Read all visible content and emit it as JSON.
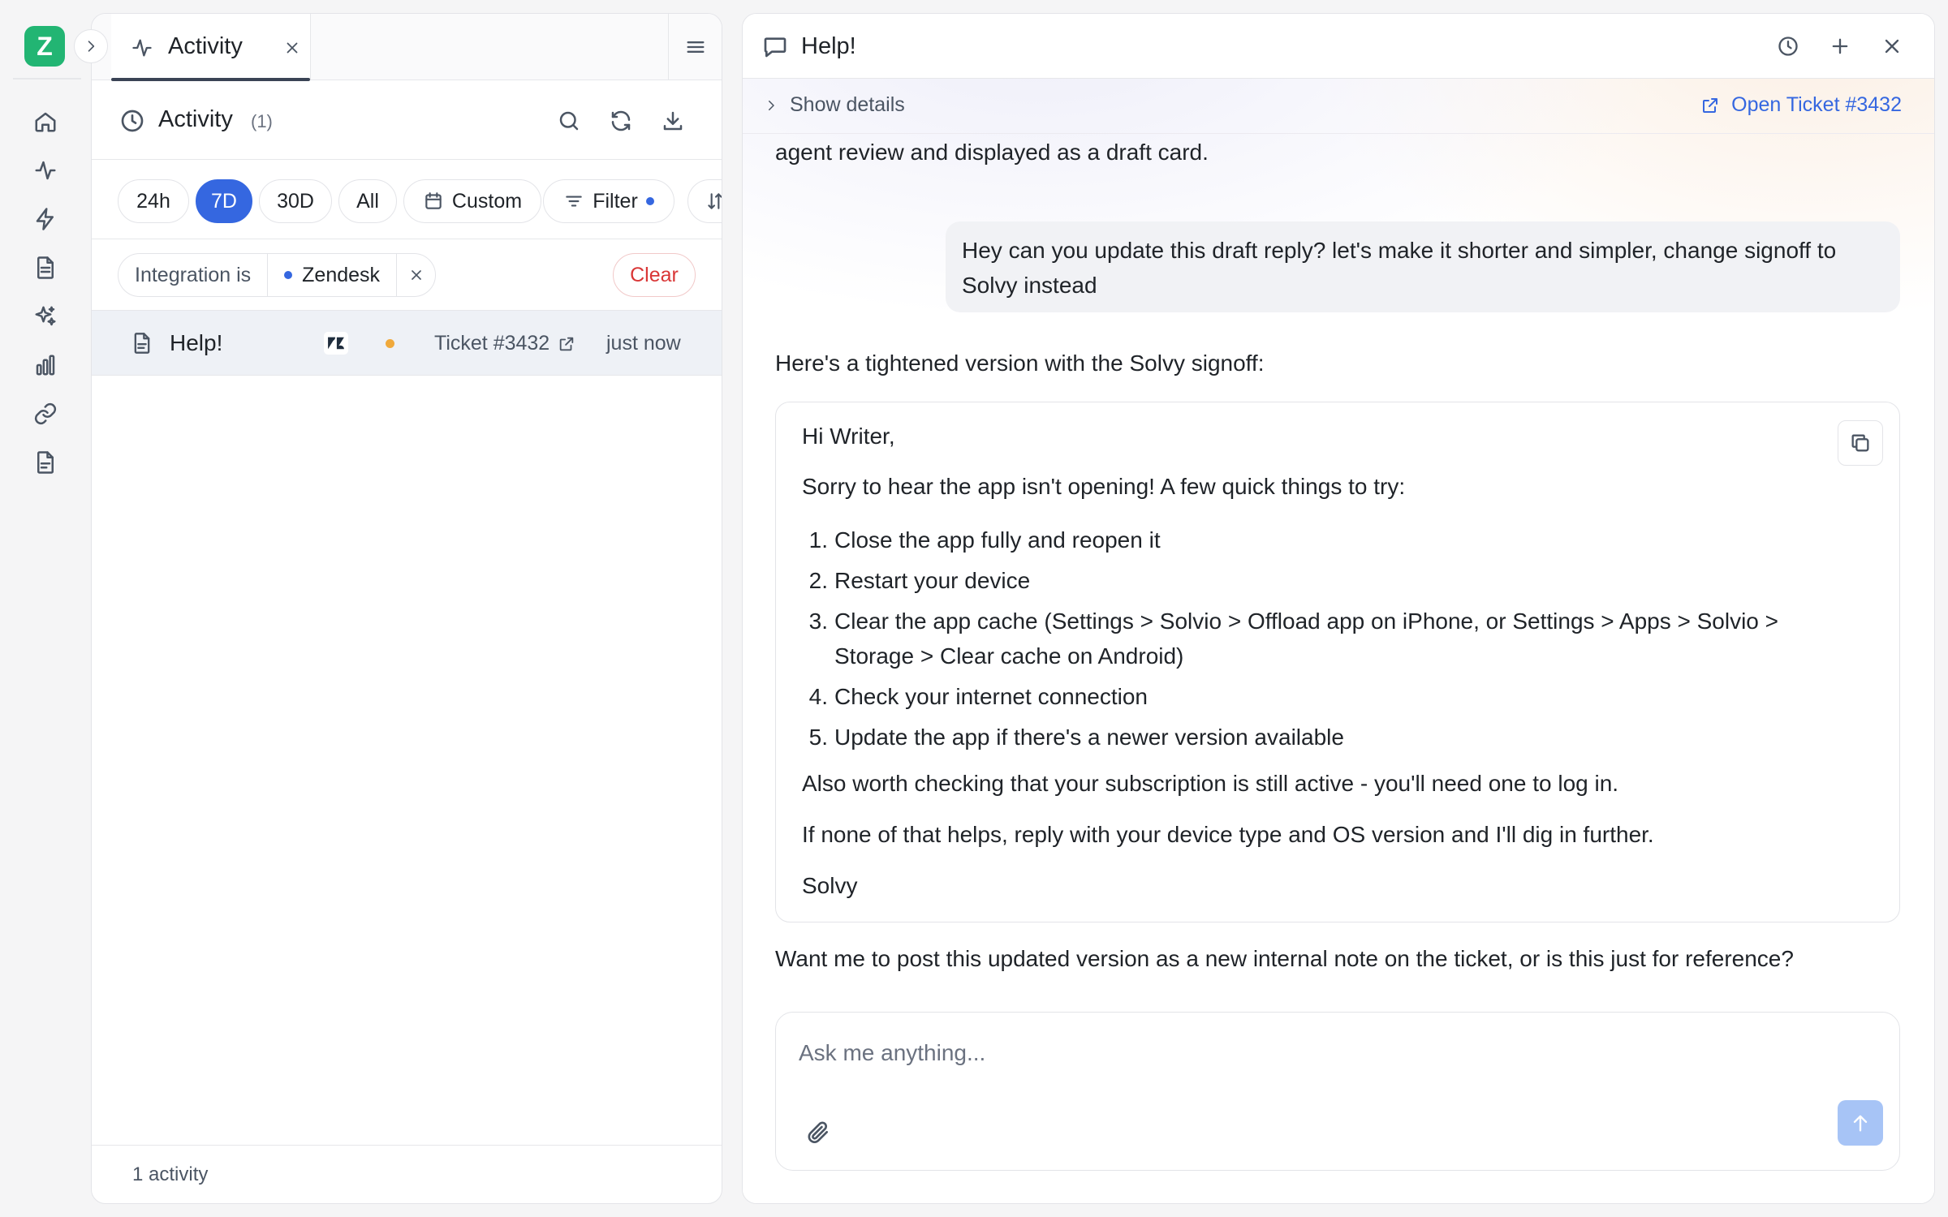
{
  "rail": {
    "avatar_letter": "Z",
    "items": [
      "home-icon",
      "activity-icon",
      "lightning-icon",
      "document-icon",
      "sparkles-icon",
      "bar-chart-icon",
      "link-icon",
      "file-text-icon"
    ]
  },
  "activity": {
    "tab_label": "Activity",
    "title": "Activity",
    "count": "(1)",
    "ranges": [
      "24h",
      "7D",
      "30D",
      "All"
    ],
    "active_range": "7D",
    "custom_label": "Custom",
    "filter_label": "Filter",
    "filter": {
      "key": "Integration is",
      "value": "Zendesk"
    },
    "clear_label": "Clear",
    "row": {
      "title": "Help!",
      "ticket": "Ticket #3432",
      "time": "just now"
    },
    "footer": "1 activity"
  },
  "chat": {
    "title": "Help!",
    "show_details": "Show details",
    "open_ticket": "Open Ticket #3432",
    "prev_tail": "agent review and displayed as a draft card.",
    "user_message": "Hey can you update this draft reply? let's make it shorter and simpler, change signoff to Solvy instead",
    "assistant_intro": "Here's a tightened version with the Solvy signoff:",
    "draft": {
      "greeting": "Hi Writer,",
      "opening": "Sorry to hear the app isn't opening! A few quick things to try:",
      "steps": [
        "Close the app fully and reopen it",
        "Restart your device",
        "Clear the app cache (Settings > Solvio > Offload app on iPhone, or Settings > Apps > Solvio > Storage > Clear cache on Android)",
        "Check your internet connection",
        "Update the app if there's a newer version available"
      ],
      "note": "Also worth checking that your subscription is still active - you'll need one to log in.",
      "closing": "If none of that helps, reply with your device type and OS version and I'll dig in further.",
      "signoff": "Solvy"
    },
    "assistant_question": "Want me to post this updated version as a new internal note on the ticket, or is this just for reference?",
    "input_placeholder": "Ask me anything..."
  },
  "colors": {
    "accent": "#3567e0",
    "brand": "#22b573",
    "clear": "#d93636",
    "status_dot": "#f0a93b"
  }
}
